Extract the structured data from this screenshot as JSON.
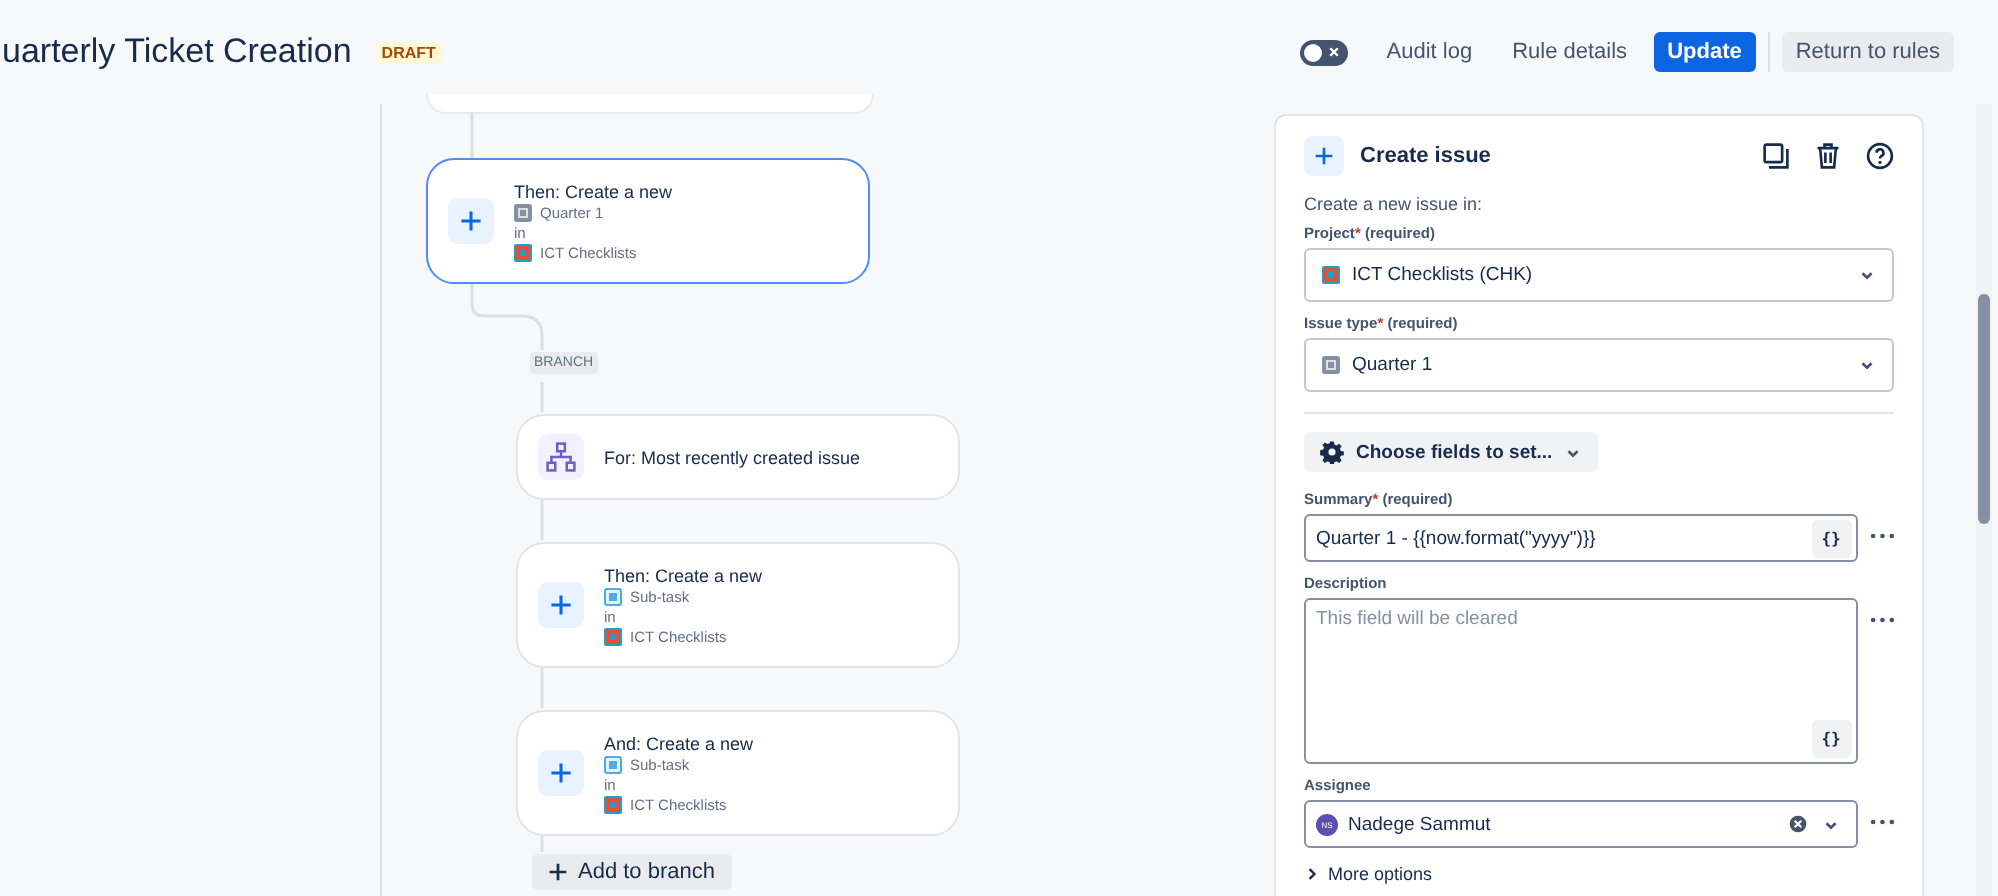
{
  "header": {
    "title": "uarterly Ticket Creation",
    "status_badge": "DRAFT",
    "toggle": {
      "on": false
    },
    "buttons": [
      {
        "label": "Audit log",
        "kind": "subtle"
      },
      {
        "label": "Rule details",
        "kind": "subtle"
      },
      {
        "label": "Update",
        "kind": "primary"
      },
      {
        "label": "Return to rules",
        "kind": "default"
      }
    ]
  },
  "flow": {
    "main_node": {
      "kind": "action",
      "title": "Then: Create a new",
      "issue_type": "Quarter 1",
      "in": "in",
      "project": "ICT Checklists",
      "selected": true
    },
    "branch": {
      "label": "BRANCH",
      "add_button": "Add to branch",
      "nodes": [
        {
          "kind": "for",
          "title": "For: Most recently created issue",
          "selected": false
        },
        {
          "kind": "action",
          "title": "Then: Create a new",
          "issue_type": "Sub-task",
          "in": "in",
          "project": "ICT Checklists",
          "selected": false
        },
        {
          "kind": "action",
          "title": "And: Create a new",
          "issue_type": "Sub-task",
          "in": "in",
          "project": "ICT Checklists",
          "selected": false
        }
      ]
    }
  },
  "panel": {
    "title": "Create issue",
    "intro": "Create a new issue in:",
    "location_fields": [
      {
        "label": "Project",
        "required_mark": "*",
        "required_note": "(required)",
        "value": "ICT Checklists (CHK)"
      },
      {
        "label": "Issue type",
        "required_mark": "*",
        "required_note": "(required)",
        "value": "Quarter 1"
      }
    ],
    "choose_fields_button": "Choose fields to set...",
    "fields": [
      {
        "kind": "text",
        "label": "Summary",
        "required_mark": "*",
        "required_note": "(required)",
        "value": "Quarter 1 - {{now.format(\"yyyy\")}}",
        "smart_button": "{}"
      },
      {
        "kind": "textarea",
        "label": "Description",
        "placeholder": "This field will be cleared",
        "smart_button": "{}"
      },
      {
        "kind": "user",
        "label": "Assignee",
        "value": "Nadege Sammut",
        "initials": "NS"
      }
    ],
    "more_options": "More options"
  }
}
